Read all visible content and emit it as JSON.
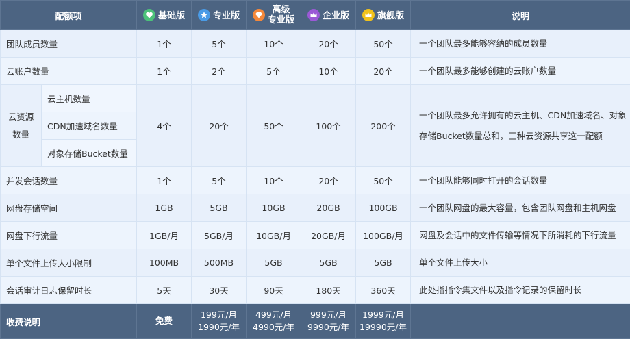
{
  "header": {
    "item_col": "配额项",
    "desc_col": "说明",
    "plans": [
      {
        "name": "基础版",
        "icon": "heart-icon",
        "color": "#4cc27a"
      },
      {
        "name": "专业版",
        "icon": "star-icon",
        "color": "#4a9be6"
      },
      {
        "name": "高级专业版",
        "name_lines": [
          "高级",
          "专业版"
        ],
        "icon": "gem-icon",
        "color": "#f5883a"
      },
      {
        "name": "企业版",
        "icon": "crown-icon",
        "color": "#9b59d6"
      },
      {
        "name": "旗舰版",
        "icon": "crown-gold-icon",
        "color": "#f1c21b"
      }
    ]
  },
  "rows": [
    {
      "label": "团队成员数量",
      "values": [
        "1个",
        "5个",
        "10个",
        "20个",
        "50个"
      ],
      "desc": "一个团队最多能够容纳的成员数量"
    },
    {
      "label": "云账户数量",
      "values": [
        "1个",
        "2个",
        "5个",
        "10个",
        "20个"
      ],
      "desc": "一个团队最多能够创建的云账户数量"
    },
    {
      "label": "云资源数量",
      "label_lines": [
        "云资源",
        "数量"
      ],
      "sub_items": [
        "云主机数量",
        "CDN加速域名数量",
        "对象存储Bucket数量"
      ],
      "values": [
        "4个",
        "20个",
        "50个",
        "100个",
        "200个"
      ],
      "desc": "一个团队最多允许拥有的云主机、CDN加速域名、对象存储Bucket数量总和，三种云资源共享这一配额"
    },
    {
      "label": "并发会话数量",
      "values": [
        "1个",
        "5个",
        "10个",
        "20个",
        "50个"
      ],
      "desc": "一个团队能够同时打开的会话数量"
    },
    {
      "label": "网盘存储空间",
      "values": [
        "1GB",
        "5GB",
        "10GB",
        "20GB",
        "100GB"
      ],
      "desc": "一个团队网盘的最大容量，包含团队网盘和主机网盘"
    },
    {
      "label": "网盘下行流量",
      "values": [
        "1GB/月",
        "5GB/月",
        "10GB/月",
        "20GB/月",
        "100GB/月"
      ],
      "desc": "网盘及会话中的文件传输等情况下所消耗的下行流量"
    },
    {
      "label": "单个文件上传大小限制",
      "values": [
        "100MB",
        "500MB",
        "5GB",
        "5GB",
        "5GB"
      ],
      "desc": "单个文件上传大小"
    },
    {
      "label": "会话审计日志保留时长",
      "values": [
        "5天",
        "30天",
        "90天",
        "180天",
        "360天"
      ],
      "desc": "此处指指令集文件以及指令记录的保留时长"
    }
  ],
  "footer": {
    "label": "收费说明",
    "prices": [
      [
        "免费"
      ],
      [
        "199元/月",
        "1990元/年"
      ],
      [
        "499元/月",
        "4990元/年"
      ],
      [
        "999元/月",
        "9990元/年"
      ],
      [
        "1999元/月",
        "19990元/年"
      ]
    ]
  }
}
